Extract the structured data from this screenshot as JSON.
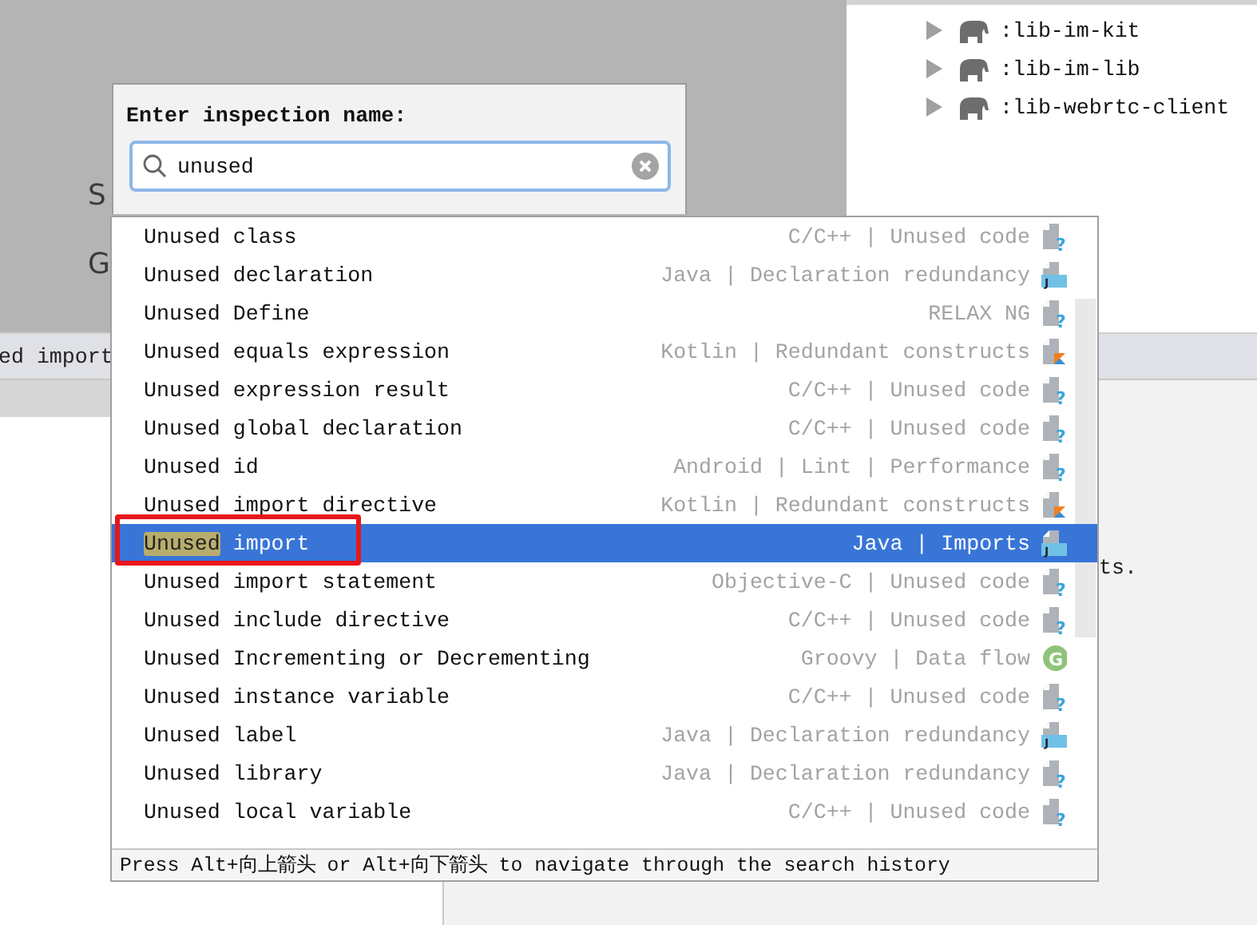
{
  "background": {
    "partial_labels": [
      "S",
      "G"
    ],
    "tree": [
      {
        "label": ":lib-im-kit",
        "expanded": false
      },
      {
        "label": ":lib-im-lib",
        "expanded": false
      },
      {
        "label": ":lib-webrtc-client",
        "expanded": false
      }
    ],
    "tab_text": "ed import",
    "side_text": "ts."
  },
  "dialog": {
    "title": "Enter inspection name:",
    "search": {
      "value": "unused"
    }
  },
  "results": [
    {
      "match": "Unused",
      "rest": "class",
      "category": "C/C++ | Unused code",
      "kind": "file",
      "badge": "?",
      "selected": false
    },
    {
      "match": "Unused",
      "rest": "declaration",
      "category": "Java | Declaration redundancy",
      "kind": "java",
      "badge": "J",
      "selected": false
    },
    {
      "match": "Unused",
      "rest": "Define",
      "category": "RELAX NG",
      "kind": "file",
      "badge": "?",
      "selected": false
    },
    {
      "match": "Unused",
      "rest": "equals expression",
      "category": "Kotlin | Redundant constructs",
      "kind": "kotlin",
      "selected": false
    },
    {
      "match": "Unused",
      "rest": "expression result",
      "category": "C/C++ | Unused code",
      "kind": "file",
      "badge": "?",
      "selected": false
    },
    {
      "match": "Unused",
      "rest": "global declaration",
      "category": "C/C++ | Unused code",
      "kind": "file",
      "badge": "?",
      "selected": false
    },
    {
      "match": "Unused",
      "rest": "id",
      "category": "Android | Lint | Performance",
      "kind": "file",
      "badge": "?",
      "selected": false
    },
    {
      "match": "Unused",
      "rest": "import directive",
      "category": "Kotlin | Redundant constructs",
      "kind": "kotlin",
      "selected": false
    },
    {
      "match": "Unused",
      "rest": "import",
      "category": "Java | Imports",
      "kind": "java",
      "badge": "J",
      "selected": true
    },
    {
      "match": "Unused",
      "rest": "import statement",
      "category": "Objective-C | Unused code",
      "kind": "file",
      "badge": "?",
      "selected": false
    },
    {
      "match": "Unused",
      "rest": "include directive",
      "category": "C/C++ | Unused code",
      "kind": "file",
      "badge": "?",
      "selected": false
    },
    {
      "match": "Unused",
      "rest": "Incrementing or Decrementing",
      "category": "Groovy | Data flow",
      "kind": "circle",
      "badge": "G",
      "selected": false
    },
    {
      "match": "Unused",
      "rest": "instance variable",
      "category": "C/C++ | Unused code",
      "kind": "file",
      "badge": "?",
      "selected": false
    },
    {
      "match": "Unused",
      "rest": "label",
      "category": "Java | Declaration redundancy",
      "kind": "java",
      "badge": "J",
      "selected": false
    },
    {
      "match": "Unused",
      "rest": "library",
      "category": "Java | Declaration redundancy",
      "kind": "file",
      "badge": "?",
      "selected": false
    },
    {
      "match": "Unused",
      "rest": "local variable",
      "category": "C/C++ | Unused code",
      "kind": "file",
      "badge": "?",
      "selected": false
    }
  ],
  "hint": "Press Alt+向上箭头 or Alt+向下箭头 to navigate through the search history"
}
